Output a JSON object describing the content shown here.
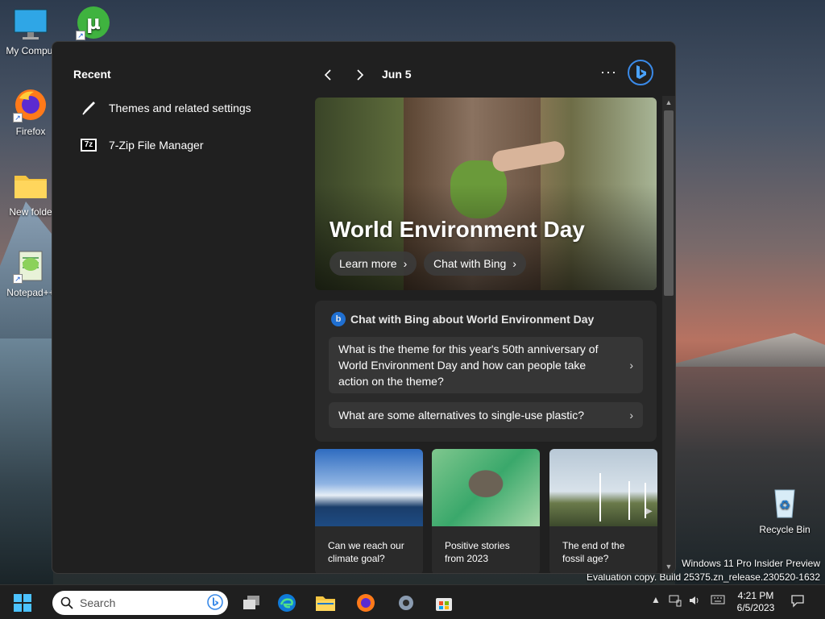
{
  "desktop": {
    "icons": [
      {
        "label": "My Comput",
        "icon": "computer-icon"
      },
      {
        "label": "",
        "icon": "utorrent-icon"
      },
      {
        "label": "Firefox",
        "icon": "firefox-icon"
      },
      {
        "label": "New folde",
        "icon": "folder-icon"
      },
      {
        "label": "Notepad++",
        "icon": "notepadpp-icon"
      },
      {
        "label": "Recycle Bin",
        "icon": "recycle-bin-icon"
      }
    ],
    "watermark": {
      "line1": "Windows 11 Pro Insider Preview",
      "line2": "Evaluation copy. Build 25375.zn_release.230520-1632"
    }
  },
  "widget_panel": {
    "recent": {
      "title": "Recent",
      "items": [
        {
          "label": "Themes and related settings",
          "icon": "brush-icon"
        },
        {
          "label": "7-Zip File Manager",
          "icon": "7zip-icon"
        }
      ]
    },
    "header": {
      "date": "Jun 5",
      "more_label": "···",
      "prev_icon": "chevron-left-icon",
      "next_icon": "chevron-right-icon"
    },
    "hero": {
      "title": "World Environment Day",
      "learn_more": "Learn more",
      "chat_with_bing": "Chat with Bing"
    },
    "chat_card": {
      "heading": "Chat with Bing about World Environment Day",
      "questions": [
        "What is the theme for this year's 50th anniversary of World Environment Day and how can people take action on the theme?",
        "What are some alternatives to single-use plastic?"
      ]
    },
    "news": [
      {
        "caption": "Can we reach our climate goal?"
      },
      {
        "caption": "Positive stories from 2023"
      },
      {
        "caption": "The end of the fossil age?"
      }
    ]
  },
  "taskbar": {
    "search_placeholder": "Search",
    "clock_time": "4:21 PM",
    "clock_date": "6/5/2023",
    "apps": [
      "start-icon",
      "task-view-icon",
      "edge-icon",
      "file-explorer-icon",
      "firefox-icon",
      "settings-icon",
      "store-icon"
    ]
  },
  "colors": {
    "panel_bg": "#202020",
    "card_bg": "#2a2a2a",
    "accent": "#1f6fd1",
    "taskbar_bg": "#1f1f1f"
  }
}
